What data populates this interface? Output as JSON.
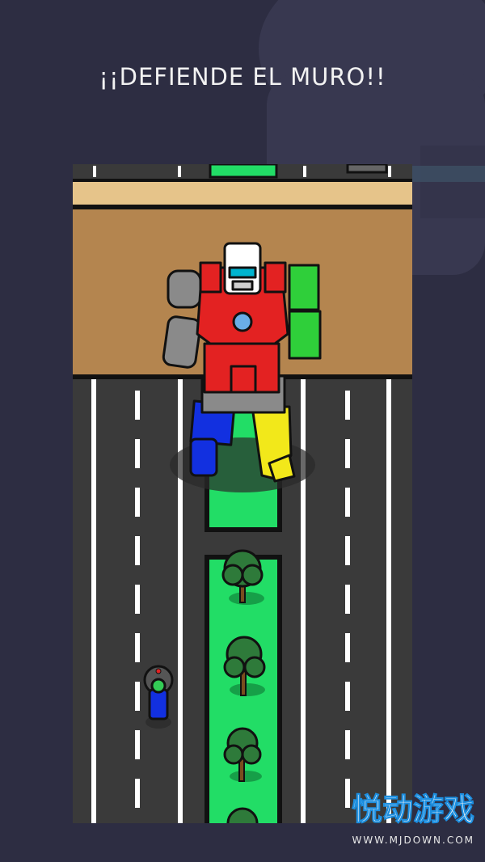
{
  "header": {
    "title": "¡¡DEFIENDE EL MURO!!"
  },
  "game": {
    "scene_name": "wall-defense-street",
    "colors": {
      "background": "#2d2d42",
      "road": "#3a3a3a",
      "lane_line": "#ffffff",
      "wall": "#b4854f",
      "wall_top": "#e6c48a",
      "median_grass": "#22dd66",
      "robot_body": "#e32222",
      "robot_gray": "#8a8a8a",
      "robot_blue": "#1230e0",
      "robot_yellow": "#f2e81a",
      "robot_green": "#2fcf3a"
    },
    "entities": {
      "robot": "red-giant-robot",
      "player": "green-helmet-scooter-rider",
      "trees": "median-tree"
    }
  },
  "watermark": {
    "logo_text": "悦动游戏",
    "url": "WWW.MJDOWN.COM",
    "logo_color": "#1d8fe0"
  }
}
